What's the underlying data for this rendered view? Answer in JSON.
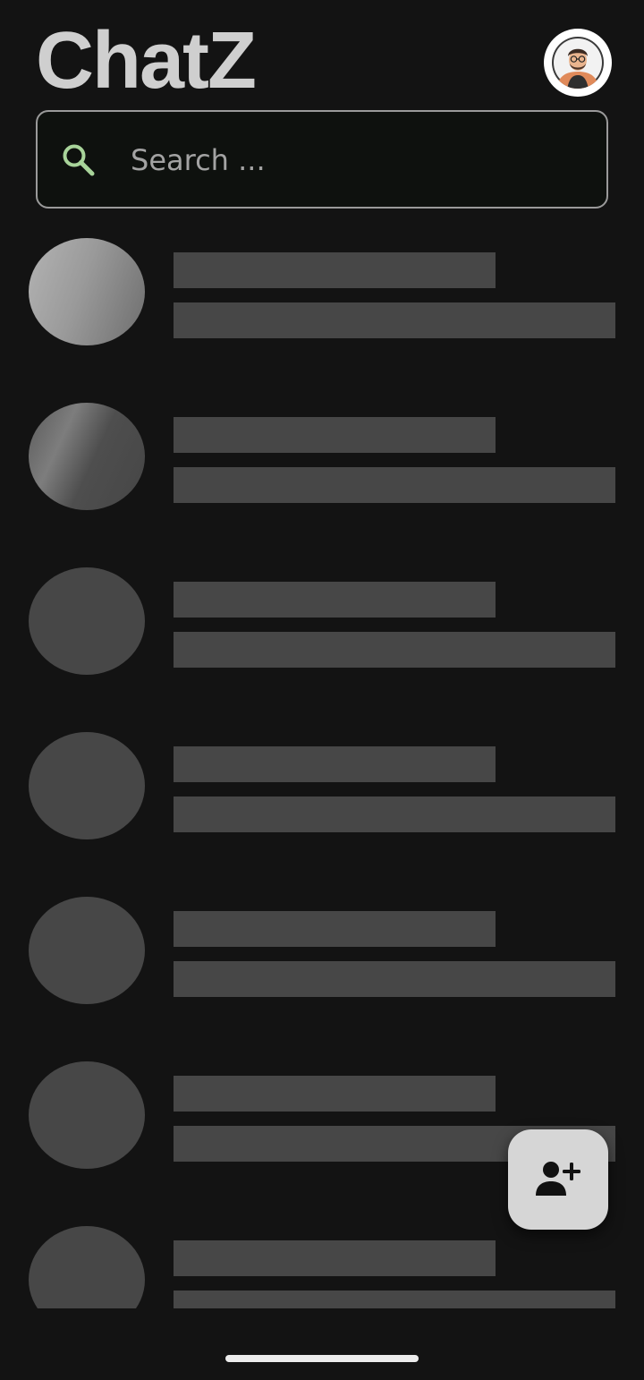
{
  "header": {
    "title": "ChatZ",
    "profile_icon": "user-avatar-icon"
  },
  "search": {
    "placeholder": "Search ...",
    "value": "",
    "icon": "search-icon",
    "icon_color": "#a8d49a"
  },
  "chat_list": {
    "state": "loading-skeleton",
    "visible_placeholder_rows": 7
  },
  "fab": {
    "icon": "add-user-icon"
  },
  "colors": {
    "background": "#131313",
    "skeleton": "#474747",
    "title": "#cfcfcf",
    "fab_background": "#d6d6d6"
  }
}
